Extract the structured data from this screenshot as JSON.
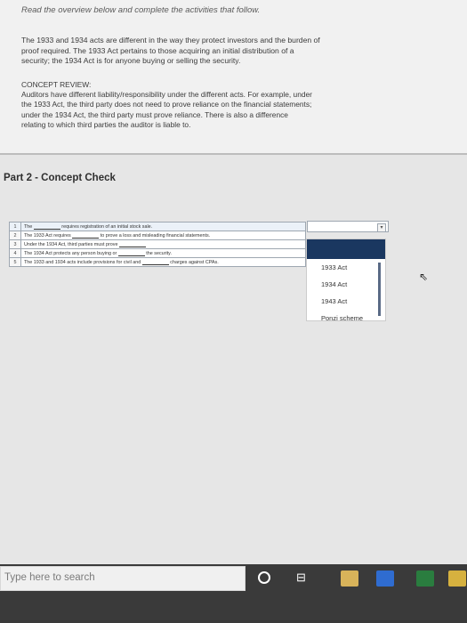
{
  "page": {
    "instructions": "Read the overview below and complete the activities that follow.",
    "overview_lines": [
      "The 1933 and 1934 acts are different in the way they protect investors and the burden of",
      "proof required. The 1933 Act pertains to those acquiring an initial distribution of a",
      "security; the 1934 Act is for anyone buying or selling the security."
    ],
    "concept_review": {
      "heading": "CONCEPT REVIEW:",
      "lines": [
        "Auditors have different liability/responsibility under the different acts. For example, under",
        "the 1933 Act, the third party does not need to prove reliance on the financial statements;",
        "under the 1934 Act, the third party must prove reliance. There is also a difference",
        "relating to which third parties the auditor is liable to."
      ]
    },
    "part_title": "Part 2 - Concept Check",
    "rows": [
      {
        "num": "1",
        "a": "The",
        "b": "requires registration of an initial stock sale.",
        "c": ""
      },
      {
        "num": "2",
        "a": "The 1933 Act requires",
        "b": "to prove a loss and misleading financial statements.",
        "c": ""
      },
      {
        "num": "3",
        "a": "Under the 1934 Act, third parties must prove",
        "b": "",
        "c": ""
      },
      {
        "num": "4",
        "a": "The 1934 Act protects any person buying or",
        "b": "the security.",
        "c": ""
      },
      {
        "num": "5",
        "a": "The 1933 and 1934 acts include provisions for civil and",
        "b": "charges against CPAs.",
        "c": ""
      }
    ],
    "dropdown": {
      "button_glyph": "▾",
      "options": [
        "1933 Act",
        "1934 Act",
        "1943 Act",
        "Ponzi scheme"
      ]
    },
    "taskbar": {
      "search_placeholder": "Type here to search",
      "task_view_glyph": "⊟"
    },
    "cursor_glyph": "⇖"
  }
}
